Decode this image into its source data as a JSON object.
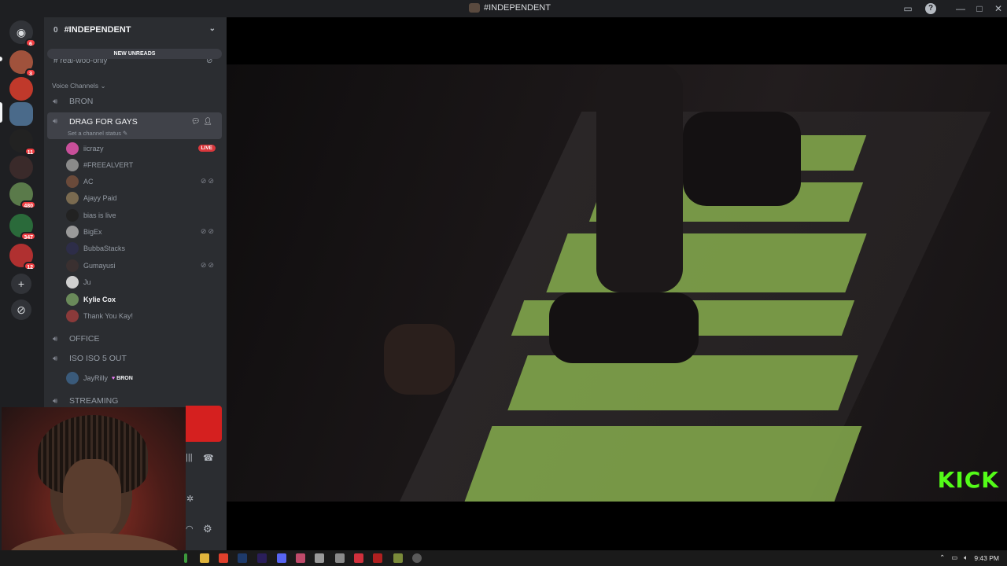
{
  "window": {
    "title": "#INDEPENDENT"
  },
  "server": {
    "name": "#INDEPENDENT",
    "channel_count_icon": "0"
  },
  "banner": {
    "new_unreads": "NEW UNREADS"
  },
  "text_channel": {
    "name": "real-woo-only"
  },
  "voice_category": {
    "label": "Voice Channels"
  },
  "voice_channels": [
    {
      "name": "BRON"
    },
    {
      "name": "DRAG FOR GAYS",
      "status": "Set a channel status"
    },
    {
      "name": "OFFICE"
    },
    {
      "name": "ISO ISO 5 OUT"
    },
    {
      "name": "STREAMING"
    }
  ],
  "drag_users": [
    {
      "name": "iicrazy",
      "badge": "LIVE",
      "color": "#c84f9a"
    },
    {
      "name": "#FREEALVERT",
      "color": "#8a8a8a"
    },
    {
      "name": "AC",
      "muted": true,
      "color": "#6a4a3a"
    },
    {
      "name": "Ajayy Paid",
      "color": "#7a6a50"
    },
    {
      "name": "bias is live",
      "color": "#222222"
    },
    {
      "name": "BigEx",
      "muted": true,
      "color": "#9a9a9a"
    },
    {
      "name": "BubbaStacks",
      "color": "#2d2d48"
    },
    {
      "name": "Gumayusi",
      "muted": true,
      "color": "#3a3030"
    },
    {
      "name": "Ju",
      "color": "#d0d0d0"
    },
    {
      "name": "Kylie Cox",
      "bright": true,
      "color": "#6a8a5a"
    },
    {
      "name": "Thank You Kay!",
      "color": "#8a3a3a"
    }
  ],
  "iso_users": [
    {
      "name": "JayRilly",
      "tag": "BRON",
      "color": "#3a5a7a"
    }
  ],
  "servers": [
    {
      "badge": "6",
      "color": "#5865f2"
    },
    {
      "badge": "3",
      "color": "#a0523c"
    },
    {
      "badge": "",
      "color": "#c0392b"
    },
    {
      "badge": "",
      "color": "#4a6a8a"
    },
    {
      "badge": "11",
      "color": "#222222"
    },
    {
      "badge": "",
      "color": "#3a2a2a"
    },
    {
      "badge": "480",
      "color": "#5a7a4a"
    },
    {
      "badge": "347",
      "color": "#2a6a3a"
    },
    {
      "badge": "12",
      "color": "#b03030"
    }
  ],
  "video": {
    "watermark": "KICK"
  },
  "taskbar": {
    "time": "9:43 PM"
  },
  "colors": {
    "accent_green": "#53fc18",
    "live_red": "#da373c",
    "sidebar": "#2b2d31"
  }
}
